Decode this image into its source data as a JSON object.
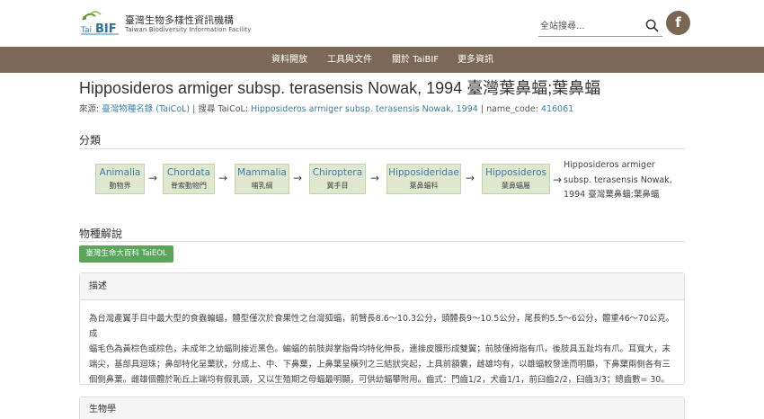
{
  "header": {
    "logo_name_zh": "臺灣生物多樣性資訊機構",
    "logo_name_en": "Taiwan Biodiversity Information Facility",
    "search_placeholder": "全站搜尋...",
    "facebook_label": "f"
  },
  "nav": {
    "items": [
      "資料開放",
      "工具與文件",
      "關於 TaiBIF",
      "更多資訊"
    ]
  },
  "page": {
    "title": "Hipposideros armiger subsp. terasensis Nowak, 1994 臺灣葉鼻蝠;葉鼻蝠",
    "source_label": "來源:",
    "source_value": "臺灣物種名錄 (TaiCoL)",
    "search_label": "| 搜尋 TaiCoL:",
    "search_value": "Hipposideros armiger subsp. terasensis Nowak, 1994",
    "name_code_label": "| name_code:",
    "name_code_value": "416061"
  },
  "classification": {
    "heading": "分類",
    "ranks": [
      {
        "sci": "Animalia",
        "zh": "動物界"
      },
      {
        "sci": "Chordata",
        "zh": "脊索動物門"
      },
      {
        "sci": "Mammalia",
        "zh": "哺乳綱"
      },
      {
        "sci": "Chiroptera",
        "zh": "翼手目"
      },
      {
        "sci": "Hipposideridae",
        "zh": "葉鼻蝠科"
      },
      {
        "sci": "Hipposideros",
        "zh": "葉鼻蝠屬"
      }
    ],
    "arrow": "→",
    "final_arrow": "→",
    "final_line1": "Hipposideros armiger",
    "final_line2": "subsp. terasensis Nowak,",
    "final_line3": "1994 臺灣葉鼻蝠;葉鼻蝠"
  },
  "description": {
    "heading": "物種解說",
    "eol_button": "臺灣生命大百科 TaiEOL",
    "panel1_title": "描述",
    "panel1_line1": "為台灣產翼手目中最大型的食蟲蝙蝠，體型僅次於食果性之台灣狐蝠，前臂長8.6～10.3公分，頭體長9～10.5公分，尾長約5.5～6公分，體重46～70公克。成",
    "panel1_line2": "蝠毛色為黃棕色或棕色，未成年之幼蝠則接近黑色。蝙蝠的前肢與掌指骨均特化伸長，連接皮膜形成雙翼；前肢僅拇指有爪，後肢具五趾均有爪。耳寬大，末",
    "panel1_line3": "端尖，基部具迴珠；鼻部特化呈葉狀，分成上、中、下鼻葉，上鼻葉呈橫列之三結狀突起，上具前額囊，雌雄均有，以雄蝠較發達而明顯，下鼻葉兩側各有三",
    "panel1_line4": "個側鼻葉。雌雄個體於恥丘上端均有假乳頭，又以生殖期之母蝠最明顯，可供幼蝠攀附用。齒式：門齒1/2，犬齒1/1，前臼齒2/2，臼齒3/3；總齒數= 30。",
    "panel2_title": "生物學"
  }
}
